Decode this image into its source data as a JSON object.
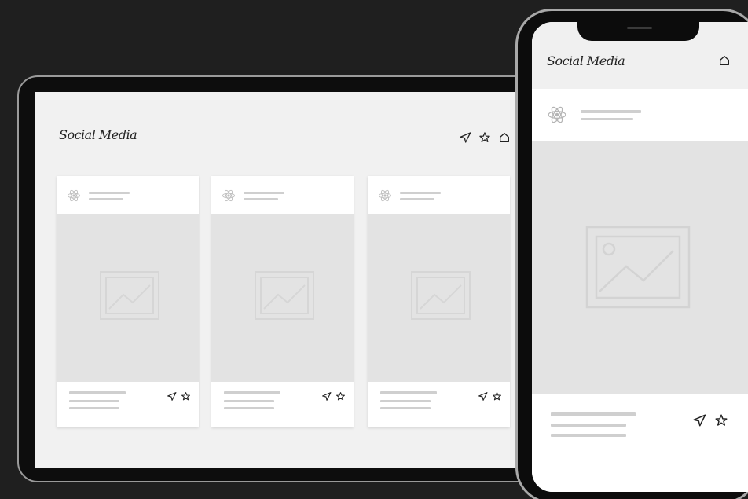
{
  "brand": {
    "name": "Social Media"
  },
  "tablet": {
    "header_icons": [
      "send-icon",
      "star-icon",
      "home-icon"
    ],
    "cards": [
      {
        "id": "card-1",
        "actions": [
          "send-icon",
          "star-icon"
        ]
      },
      {
        "id": "card-2",
        "actions": [
          "send-icon",
          "star-icon"
        ]
      },
      {
        "id": "card-3",
        "actions": [
          "send-icon",
          "star-icon"
        ]
      }
    ]
  },
  "phone": {
    "header_icons": [
      "home-icon"
    ],
    "post_actions": [
      "send-icon",
      "star-icon"
    ]
  },
  "colors": {
    "background": "#1f1f1f",
    "screen": "#f1f1f1",
    "card": "#ffffff",
    "placeholder": "#e3e3e3",
    "skeleton_line": "#cfcfcf",
    "icon": "#222222"
  }
}
